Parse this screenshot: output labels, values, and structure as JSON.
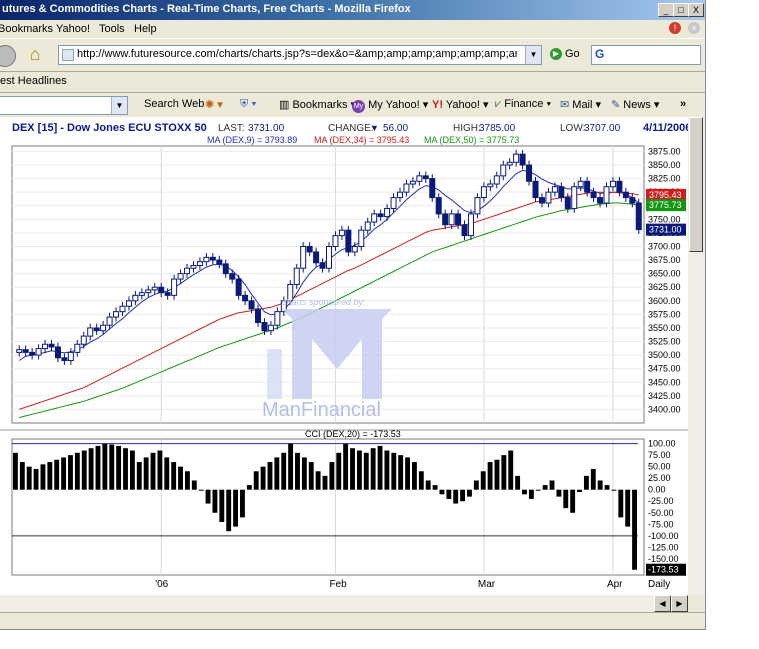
{
  "window": {
    "title": "utures & Commodities Charts - Real-Time Charts, Free Charts - Mozilla Firefox",
    "min": "_",
    "max": "□",
    "close": "X"
  },
  "menu": [
    "Bookmarks",
    "Yahoo!",
    "Tools",
    "Help"
  ],
  "nav": {
    "url": "http://www.futuresource.com/charts/charts.jsp?s=dex&o=&amp;amp;amp;amp;amp;amp;amp;amp;amp;a=",
    "go_label": "Go",
    "search_glyph": "G"
  },
  "bookmarks_bar": {
    "item": "test Headlines"
  },
  "yahoo_toolbar": {
    "items": [
      "Search Web",
      "Bookmarks",
      "My Yahoo!",
      "Yahoo!",
      "Finance",
      "Mail",
      "News"
    ],
    "more": "»"
  },
  "chart": {
    "symbol": "DEX [15] - Dow Jones ECU STOXX 50",
    "last_label": "LAST:",
    "last": "3731.00",
    "change_label": "CHANGE:",
    "change": "56.00",
    "high_label": "HIGH:",
    "high": "3785.00",
    "low_label": "LOW:",
    "low": "3707.00",
    "date": "4/11/2006",
    "ma_line": [
      {
        "text": "MA (DEX,9) = 3793.89",
        "color": "#1f2fb4"
      },
      {
        "text": "MA (DEX,34) = 3795.43",
        "color": "#d01c1c"
      },
      {
        "text": "MA (DEX,50) = 3775.73",
        "color": "#139613"
      }
    ],
    "watermark_top": "charts sponsored by:",
    "watermark_brand": "ManFinancial",
    "price_badges": [
      {
        "text": "3795.43",
        "color": "#d01c1c"
      },
      {
        "text": "3775.73",
        "color": "#139613"
      },
      {
        "text": "3731.00",
        "color": "#0a1a7a"
      }
    ],
    "cci_title": "CCI (DEX,20) = -173.53",
    "cci_badge": "-173.53",
    "x_labels": [
      "'06",
      "Feb",
      "Mar",
      "Apr"
    ],
    "period": "Daily"
  },
  "chart_data": [
    {
      "type": "candlestick",
      "title": "DEX [15] - Dow Jones ECU STOXX 50",
      "ylim": [
        3375,
        3885
      ],
      "y_ticks": [
        3400,
        3425,
        3450,
        3475,
        3500,
        3525,
        3550,
        3575,
        3600,
        3625,
        3650,
        3675,
        3700,
        3725,
        3750,
        3775,
        3800,
        3825,
        3850,
        3875
      ],
      "closes": [
        3510,
        3505,
        3500,
        3512,
        3520,
        3515,
        3495,
        3490,
        3505,
        3520,
        3535,
        3550,
        3545,
        3555,
        3570,
        3580,
        3590,
        3600,
        3610,
        3615,
        3620,
        3625,
        3615,
        3610,
        3640,
        3650,
        3660,
        3665,
        3672,
        3680,
        3675,
        3668,
        3650,
        3640,
        3610,
        3600,
        3585,
        3560,
        3545,
        3555,
        3580,
        3600,
        3630,
        3660,
        3700,
        3690,
        3670,
        3660,
        3700,
        3720,
        3730,
        3690,
        3700,
        3730,
        3745,
        3760,
        3755,
        3770,
        3790,
        3800,
        3815,
        3820,
        3830,
        3825,
        3790,
        3760,
        3740,
        3760,
        3740,
        3720,
        3760,
        3790,
        3810,
        3815,
        3830,
        3850,
        3855,
        3870,
        3850,
        3820,
        3790,
        3780,
        3800,
        3810,
        3790,
        3770,
        3810,
        3820,
        3800,
        3790,
        3780,
        3810,
        3820,
        3800,
        3790,
        3780,
        3731
      ],
      "series": [
        {
          "name": "MA (DEX,9)",
          "values": [
            3490,
            3498,
            3500,
            3502,
            3505,
            3508,
            3506,
            3504,
            3506,
            3510,
            3516,
            3524,
            3530,
            3538,
            3548,
            3558,
            3567,
            3578,
            3588,
            3598,
            3606,
            3612,
            3616,
            3618,
            3624,
            3632,
            3640,
            3648,
            3655,
            3662,
            3666,
            3667,
            3664,
            3656,
            3644,
            3630,
            3612,
            3596,
            3580,
            3574,
            3576,
            3584,
            3596,
            3614,
            3634,
            3650,
            3662,
            3668,
            3676,
            3686,
            3694,
            3698,
            3702,
            3710,
            3720,
            3732,
            3740,
            3750,
            3762,
            3774,
            3786,
            3796,
            3806,
            3812,
            3810,
            3804,
            3794,
            3786,
            3776,
            3766,
            3762,
            3766,
            3774,
            3784,
            3796,
            3810,
            3822,
            3834,
            3840,
            3838,
            3832,
            3824,
            3818,
            3814,
            3810,
            3806,
            3806,
            3808,
            3806,
            3802,
            3798,
            3798,
            3800,
            3800,
            3796,
            3790,
            3780
          ]
        },
        {
          "name": "MA (DEX,34)",
          "values": [
            3400,
            3404,
            3408,
            3412,
            3416,
            3420,
            3424,
            3428,
            3432,
            3436,
            3440,
            3446,
            3452,
            3458,
            3464,
            3470,
            3476,
            3482,
            3488,
            3494,
            3500,
            3506,
            3512,
            3518,
            3524,
            3530,
            3536,
            3542,
            3548,
            3554,
            3560,
            3566,
            3570,
            3574,
            3578,
            3580,
            3582,
            3584,
            3586,
            3588,
            3592,
            3596,
            3602,
            3608,
            3614,
            3620,
            3626,
            3632,
            3638,
            3644,
            3650,
            3656,
            3660,
            3666,
            3672,
            3678,
            3684,
            3690,
            3696,
            3702,
            3708,
            3714,
            3720,
            3726,
            3730,
            3732,
            3734,
            3736,
            3738,
            3740,
            3742,
            3746,
            3750,
            3754,
            3758,
            3762,
            3766,
            3770,
            3774,
            3778,
            3782,
            3784,
            3786,
            3788,
            3790,
            3792,
            3794,
            3796,
            3798,
            3800,
            3800,
            3800,
            3800,
            3799,
            3798,
            3797,
            3795
          ]
        },
        {
          "name": "MA (DEX,50)",
          "values": [
            3385,
            3388,
            3391,
            3394,
            3397,
            3400,
            3403,
            3406,
            3409,
            3412,
            3415,
            3419,
            3423,
            3427,
            3431,
            3435,
            3439,
            3444,
            3449,
            3454,
            3459,
            3464,
            3469,
            3474,
            3479,
            3484,
            3489,
            3494,
            3499,
            3504,
            3509,
            3514,
            3518,
            3522,
            3526,
            3530,
            3534,
            3538,
            3542,
            3546,
            3550,
            3555,
            3560,
            3565,
            3570,
            3576,
            3582,
            3588,
            3594,
            3600,
            3606,
            3612,
            3618,
            3624,
            3630,
            3636,
            3642,
            3648,
            3654,
            3660,
            3666,
            3672,
            3678,
            3684,
            3690,
            3694,
            3698,
            3702,
            3706,
            3710,
            3714,
            3718,
            3722,
            3726,
            3730,
            3734,
            3738,
            3742,
            3746,
            3750,
            3754,
            3757,
            3760,
            3763,
            3766,
            3768,
            3770,
            3772,
            3774,
            3776,
            3778,
            3779,
            3780,
            3780,
            3779,
            3778,
            3776
          ]
        }
      ]
    },
    {
      "type": "bar",
      "title": "CCI (DEX,20) = -173.53",
      "ylim": [
        -185,
        110
      ],
      "y_ticks": [
        100,
        75,
        50,
        25,
        0,
        -25,
        -50,
        -75,
        -100,
        -125,
        -150,
        -175
      ],
      "values": [
        80,
        60,
        50,
        45,
        55,
        60,
        65,
        70,
        75,
        80,
        85,
        90,
        95,
        100,
        98,
        95,
        90,
        85,
        60,
        70,
        80,
        85,
        70,
        60,
        50,
        40,
        20,
        0,
        -30,
        -50,
        -70,
        -90,
        -80,
        -60,
        10,
        40,
        50,
        60,
        70,
        80,
        100,
        80,
        70,
        60,
        40,
        30,
        60,
        80,
        100,
        90,
        85,
        80,
        90,
        95,
        85,
        80,
        75,
        70,
        60,
        40,
        20,
        10,
        -10,
        -20,
        -30,
        -25,
        -15,
        20,
        40,
        60,
        65,
        75,
        85,
        30,
        -10,
        -20,
        0,
        10,
        20,
        -15,
        -40,
        -50,
        -5,
        30,
        45,
        20,
        10,
        0,
        -60,
        -80,
        -173.53
      ]
    }
  ]
}
